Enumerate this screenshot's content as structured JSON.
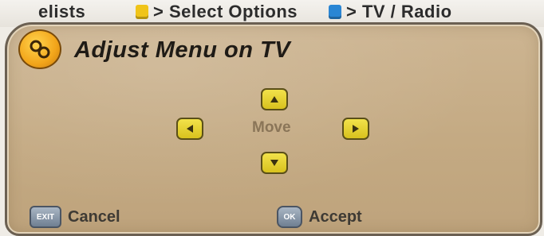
{
  "top_hints": [
    {
      "label": "elists",
      "key_color": "#f0c419",
      "key_icon": "yellow-key-icon"
    },
    {
      "label": "> Select Options",
      "key_color": "#f0c419",
      "key_icon": "yellow-key-icon"
    },
    {
      "label": "> TV / Radio",
      "key_color": "#2a86d4",
      "key_icon": "blue-key-icon"
    }
  ],
  "dialog": {
    "title": "Adjust Menu on TV",
    "logo_icon": "circle-logo-icon",
    "center_label": "Move",
    "arrows": [
      "up-arrow-icon",
      "left-arrow-icon",
      "right-arrow-icon",
      "down-arrow-icon"
    ]
  },
  "footer": {
    "cancel": {
      "key_label": "EXIT",
      "label": "Cancel"
    },
    "accept": {
      "key_label": "OK",
      "label": "Accept"
    }
  },
  "colors": {
    "panel": "#c4aa83",
    "panel_border": "#6b6052",
    "arrow_fill": "#e8d535",
    "logo_fill": "#f2a51a"
  }
}
